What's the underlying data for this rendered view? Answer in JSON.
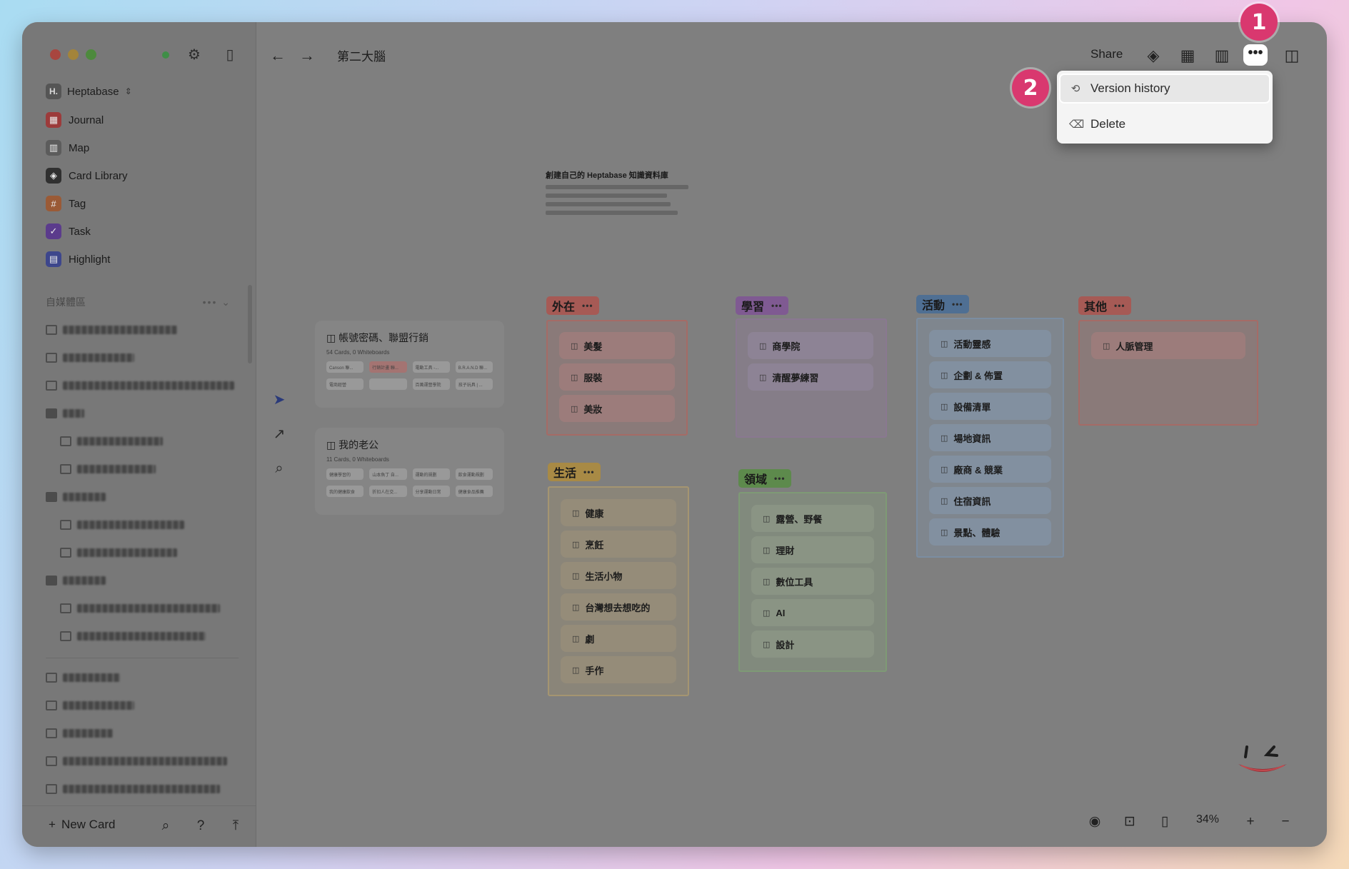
{
  "window": {
    "title": "第二大腦"
  },
  "sidebar": {
    "workspace": {
      "logo": "H.",
      "name": "Heptabase",
      "chevron": "⌃⌄"
    },
    "nav": [
      {
        "label": "Journal",
        "icon": "calendar-icon",
        "color": "#9c3b3b",
        "glyph": "▦"
      },
      {
        "label": "Map",
        "icon": "map-icon",
        "color": "#5c5c5c",
        "glyph": "▥"
      },
      {
        "label": "Card Library",
        "icon": "layers-icon",
        "color": "#303030",
        "glyph": "◈"
      },
      {
        "label": "Tag",
        "icon": "hash-icon",
        "color": "#9a5a36",
        "glyph": "#"
      },
      {
        "label": "Task",
        "icon": "check-icon",
        "color": "#5b3b8c",
        "glyph": "✓"
      },
      {
        "label": "Highlight",
        "icon": "highlight-icon",
        "color": "#3d468c",
        "glyph": "▤"
      }
    ],
    "section": {
      "label": "自媒體區",
      "more": "•••",
      "chevron": "⌄"
    },
    "footer": {
      "new_card": "New Card",
      "plus": "+"
    }
  },
  "header": {
    "share": "Share",
    "more": "•••"
  },
  "menu": {
    "items": [
      {
        "label": "Version history",
        "icon": "history-icon",
        "glyph": "⟲"
      },
      {
        "label": "Delete",
        "icon": "trash-icon",
        "glyph": "🗑"
      }
    ]
  },
  "badges": {
    "one": "1",
    "two": "2"
  },
  "canvas": {
    "note": {
      "title": "創建自己的 Heptabase 知識資料庫"
    },
    "whiteboards": [
      {
        "title": "帳號密碼、聯盟行銷",
        "sub": "54 Cards, 0 Whiteboards",
        "chips": [
          "Canson 聯...",
          "行銷計畫 聯...",
          "電動工具 -...",
          "B.R.A.N.D 聯...",
          "電商經營",
          "",
          "百萬運營學院",
          "孩子玩具 | ..."
        ]
      },
      {
        "title": "我的老公",
        "sub": "11 Cards, 0 Whiteboards",
        "chips": [
          "健康學習的",
          "山本魚丁 自...",
          "運動的規劃",
          "飲食運動規劃",
          "我的健康飲食",
          "折扣人在交...",
          "分享運動日常",
          "健康食品推薦"
        ]
      }
    ],
    "groups": {
      "outer": {
        "label": "外在",
        "items": [
          "美髮",
          "服裝",
          "美妝"
        ]
      },
      "learn": {
        "label": "學習",
        "items": [
          "商學院",
          "清醒夢練習"
        ]
      },
      "activity": {
        "label": "活動",
        "items": [
          "活動靈感",
          "企劃 & 佈置",
          "設備清單",
          "場地資訊",
          "廠商 & 競業",
          "住宿資訊",
          "景點、體驗"
        ]
      },
      "other": {
        "label": "其他",
        "items": [
          "人脈管理"
        ]
      },
      "life": {
        "label": "生活",
        "items": [
          "健康",
          "烹飪",
          "生活小物",
          "台灣想去想吃的",
          "劇",
          "手作"
        ]
      },
      "domain": {
        "label": "領域",
        "items": [
          "露營、野餐",
          "理財",
          "數位工具",
          "AI",
          "設計"
        ]
      }
    },
    "colors": {
      "outer": "#a65a55",
      "learn": "#7f5a92",
      "activity": "#4f6f93",
      "other": "#a65a55",
      "life": "#a88a45",
      "domain": "#5d8a4c"
    }
  },
  "zoom": {
    "level": "34%"
  }
}
